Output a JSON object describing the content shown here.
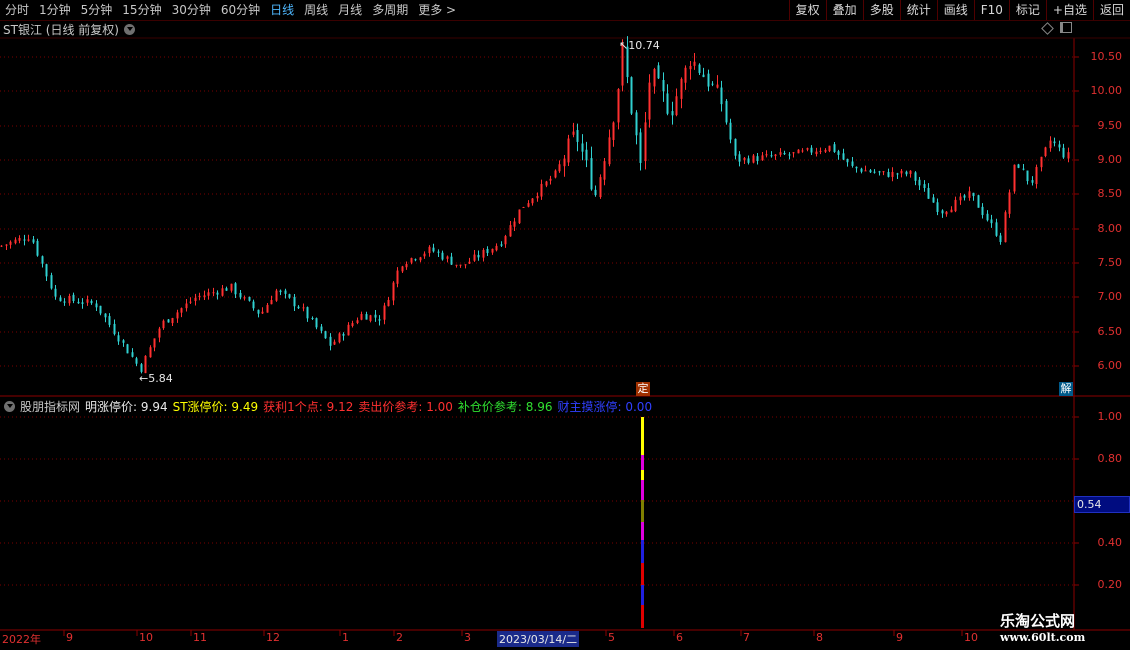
{
  "toolbar": {
    "periods": [
      {
        "label": "分时",
        "active": false
      },
      {
        "label": "1分钟",
        "active": false
      },
      {
        "label": "5分钟",
        "active": false
      },
      {
        "label": "15分钟",
        "active": false
      },
      {
        "label": "30分钟",
        "active": false
      },
      {
        "label": "60分钟",
        "active": false
      },
      {
        "label": "日线",
        "active": true
      },
      {
        "label": "周线",
        "active": false
      },
      {
        "label": "月线",
        "active": false
      },
      {
        "label": "多周期",
        "active": false
      },
      {
        "label": "更多 >",
        "active": false
      }
    ],
    "actions": [
      "复权",
      "叠加",
      "多股",
      "统计",
      "画线",
      "F10",
      "标记",
      "+自选",
      "返回"
    ]
  },
  "chart": {
    "title": "ST银江 (日线 前复权)",
    "price_scale": [
      "10.50",
      "10.00",
      "9.50",
      "9.00",
      "8.50",
      "8.00",
      "7.50",
      "7.00",
      "6.50",
      "6.00"
    ],
    "high_marker": "10.74",
    "low_marker": "5.84",
    "tag_ding": "定",
    "tag_jie": "解"
  },
  "indicator": {
    "name": "股朋指标网",
    "items": [
      {
        "text": "明涨停价: 9.94",
        "color": "#e8e8e8"
      },
      {
        "text": "ST涨停价: 9.49",
        "color": "#ffff00"
      },
      {
        "text": "获利1个点: 9.12",
        "color": "#ff3030"
      },
      {
        "text": "卖出价参考: 1.00",
        "color": "#ff3030"
      },
      {
        "text": "补仓价参考: 8.96",
        "color": "#30e030"
      },
      {
        "text": "财主摸涨停: 0.00",
        "color": "#3040ff"
      }
    ],
    "scale": [
      "1.00",
      "0.80",
      "0.60",
      "0.40",
      "0.20"
    ],
    "current_value": "0.54"
  },
  "dates": {
    "labels": [
      "2022年",
      "9",
      "10",
      "11",
      "12",
      "1",
      "2",
      "3",
      "2023/03/14/二",
      "5",
      "6",
      "7",
      "8",
      "9",
      "10"
    ]
  },
  "watermark": {
    "line1": "乐淘公式网",
    "line2": "www.60lt.com"
  },
  "colors": {
    "up": "#ff3030",
    "down": "#30d0d0",
    "grid": "#7a0000",
    "axis": "#8b0000"
  }
}
